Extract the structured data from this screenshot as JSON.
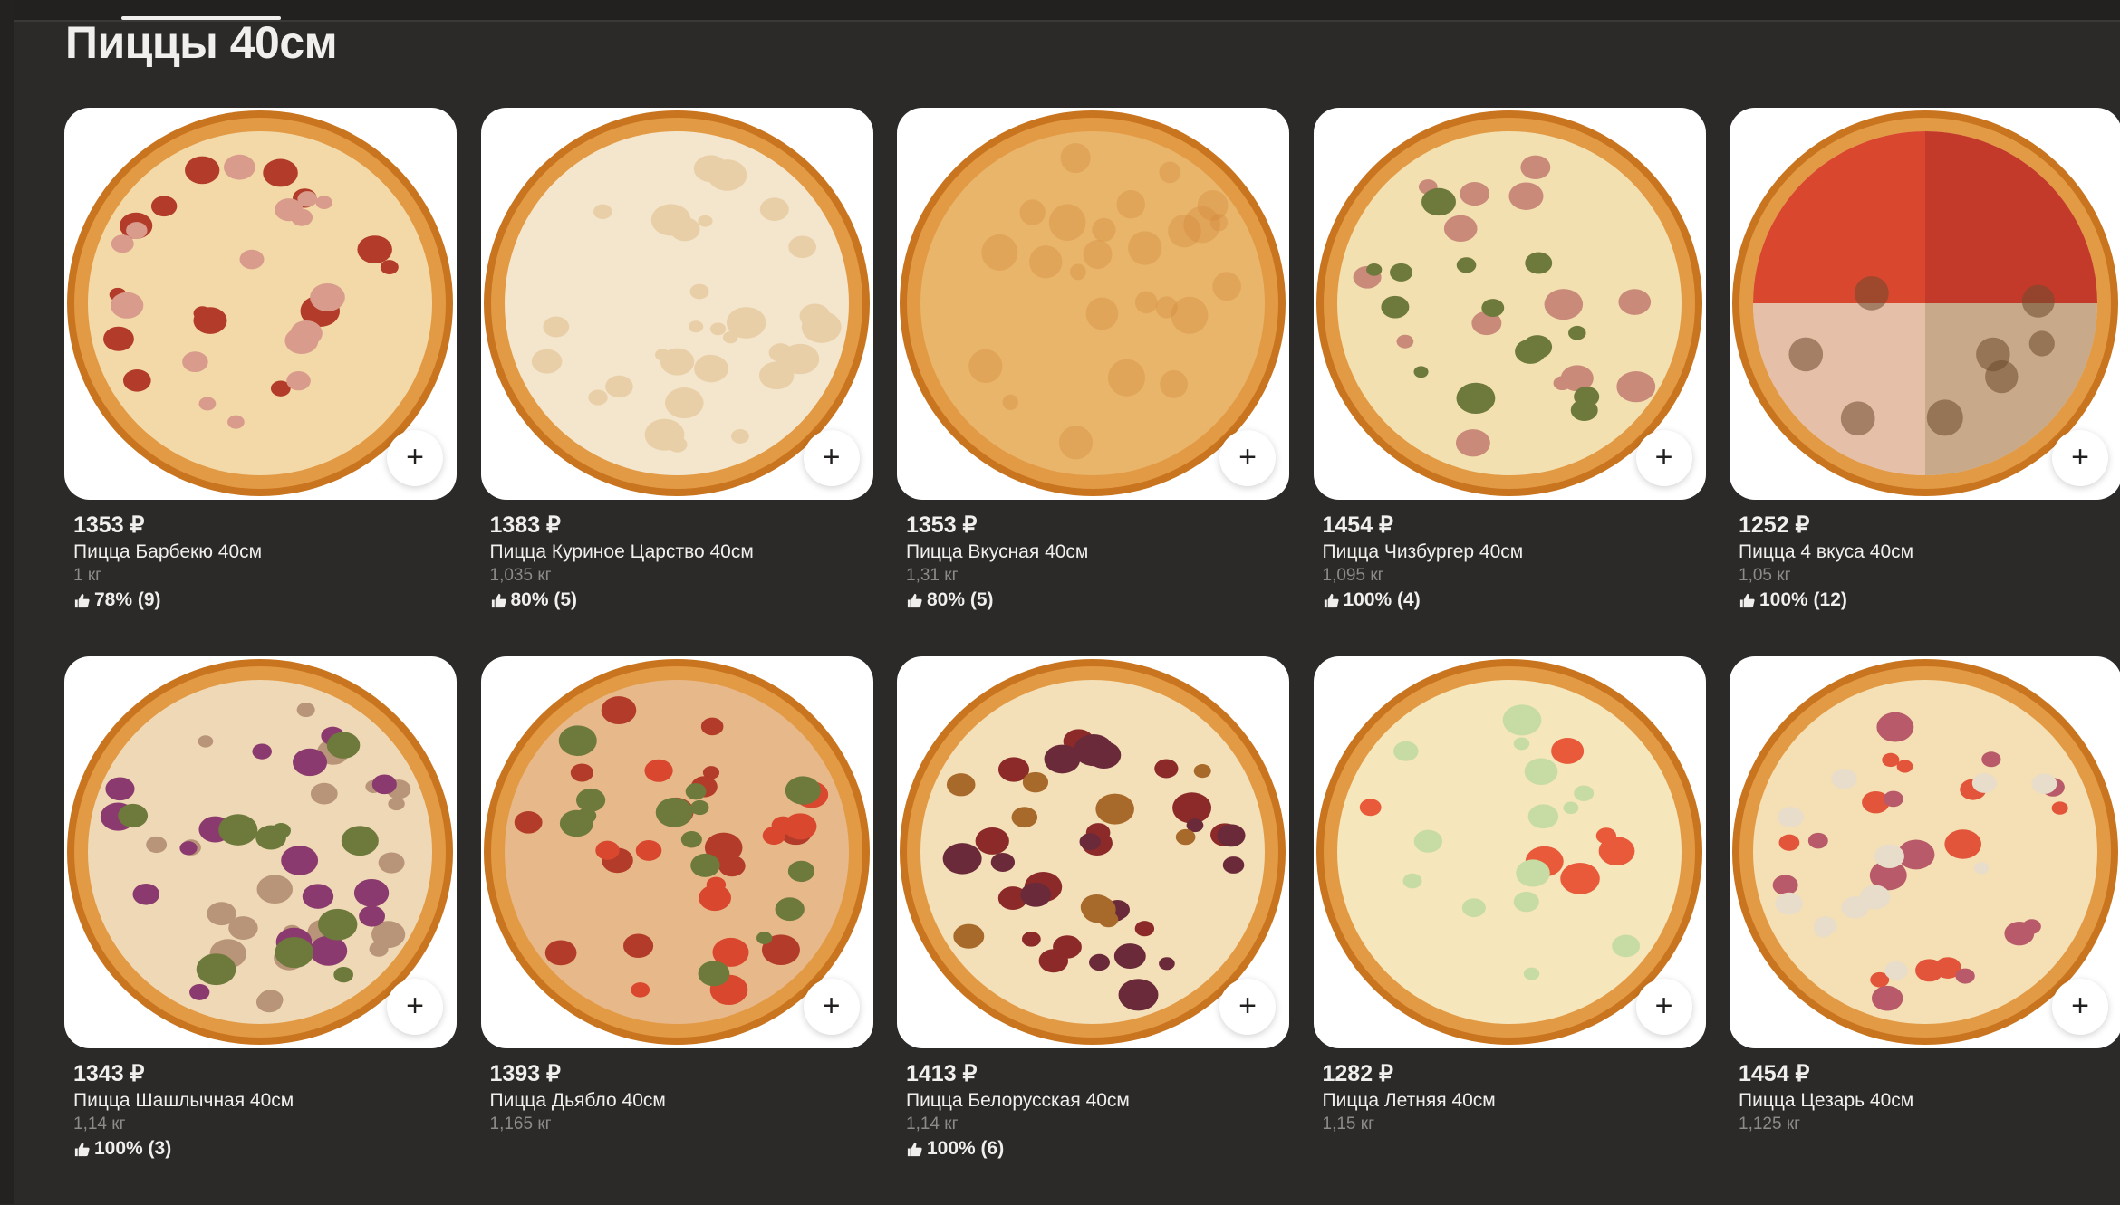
{
  "section": {
    "title": "Пиццы 40см"
  },
  "products": [
    {
      "price": "1353 ₽",
      "name": "Пицца Барбекю 40см",
      "weight": "1 кг",
      "rating": "78% (9)",
      "icon": "pizza-bbq-image",
      "add_label": "+"
    },
    {
      "price": "1383 ₽",
      "name": "Пицца Куриное Царство 40см",
      "weight": "1,035 кг",
      "rating": "80% (5)",
      "icon": "pizza-chicken-kingdom-image",
      "add_label": "+"
    },
    {
      "price": "1353 ₽",
      "name": "Пицца Вкусная 40см",
      "weight": "1,31 кг",
      "rating": "80% (5)",
      "icon": "pizza-tasty-image",
      "add_label": "+"
    },
    {
      "price": "1454 ₽",
      "name": "Пицца Чизбургер 40см",
      "weight": "1,095 кг",
      "rating": "100% (4)",
      "icon": "pizza-cheeseburger-image",
      "add_label": "+"
    },
    {
      "price": "1252 ₽",
      "name": "Пицца 4 вкуса 40см",
      "weight": "1,05 кг",
      "rating": "100% (12)",
      "icon": "pizza-4-flavors-image",
      "add_label": "+"
    },
    {
      "price": "1343 ₽",
      "name": "Пицца Шашлычная 40см",
      "weight": "1,14 кг",
      "rating": "100% (3)",
      "icon": "pizza-shashlik-image",
      "add_label": "+"
    },
    {
      "price": "1393 ₽",
      "name": "Пицца Дьябло 40см",
      "weight": "1,165 кг",
      "rating": "",
      "icon": "pizza-diablo-image",
      "add_label": "+"
    },
    {
      "price": "1413 ₽",
      "name": "Пицца Белорусская 40см",
      "weight": "1,14 кг",
      "rating": "100% (6)",
      "icon": "pizza-belarusian-image",
      "add_label": "+"
    },
    {
      "price": "1282 ₽",
      "name": "Пицца Летняя 40см",
      "weight": "1,15 кг",
      "rating": "",
      "icon": "pizza-summer-image",
      "add_label": "+"
    },
    {
      "price": "1454 ₽",
      "name": "Пицца Цезарь 40см",
      "weight": "1,125 кг",
      "rating": "",
      "icon": "pizza-caesar-image",
      "add_label": "+"
    }
  ],
  "colors": {
    "background": "#2b2a29",
    "card": "#ffffff",
    "text": "#f0efed",
    "muted": "#8d8b89"
  }
}
